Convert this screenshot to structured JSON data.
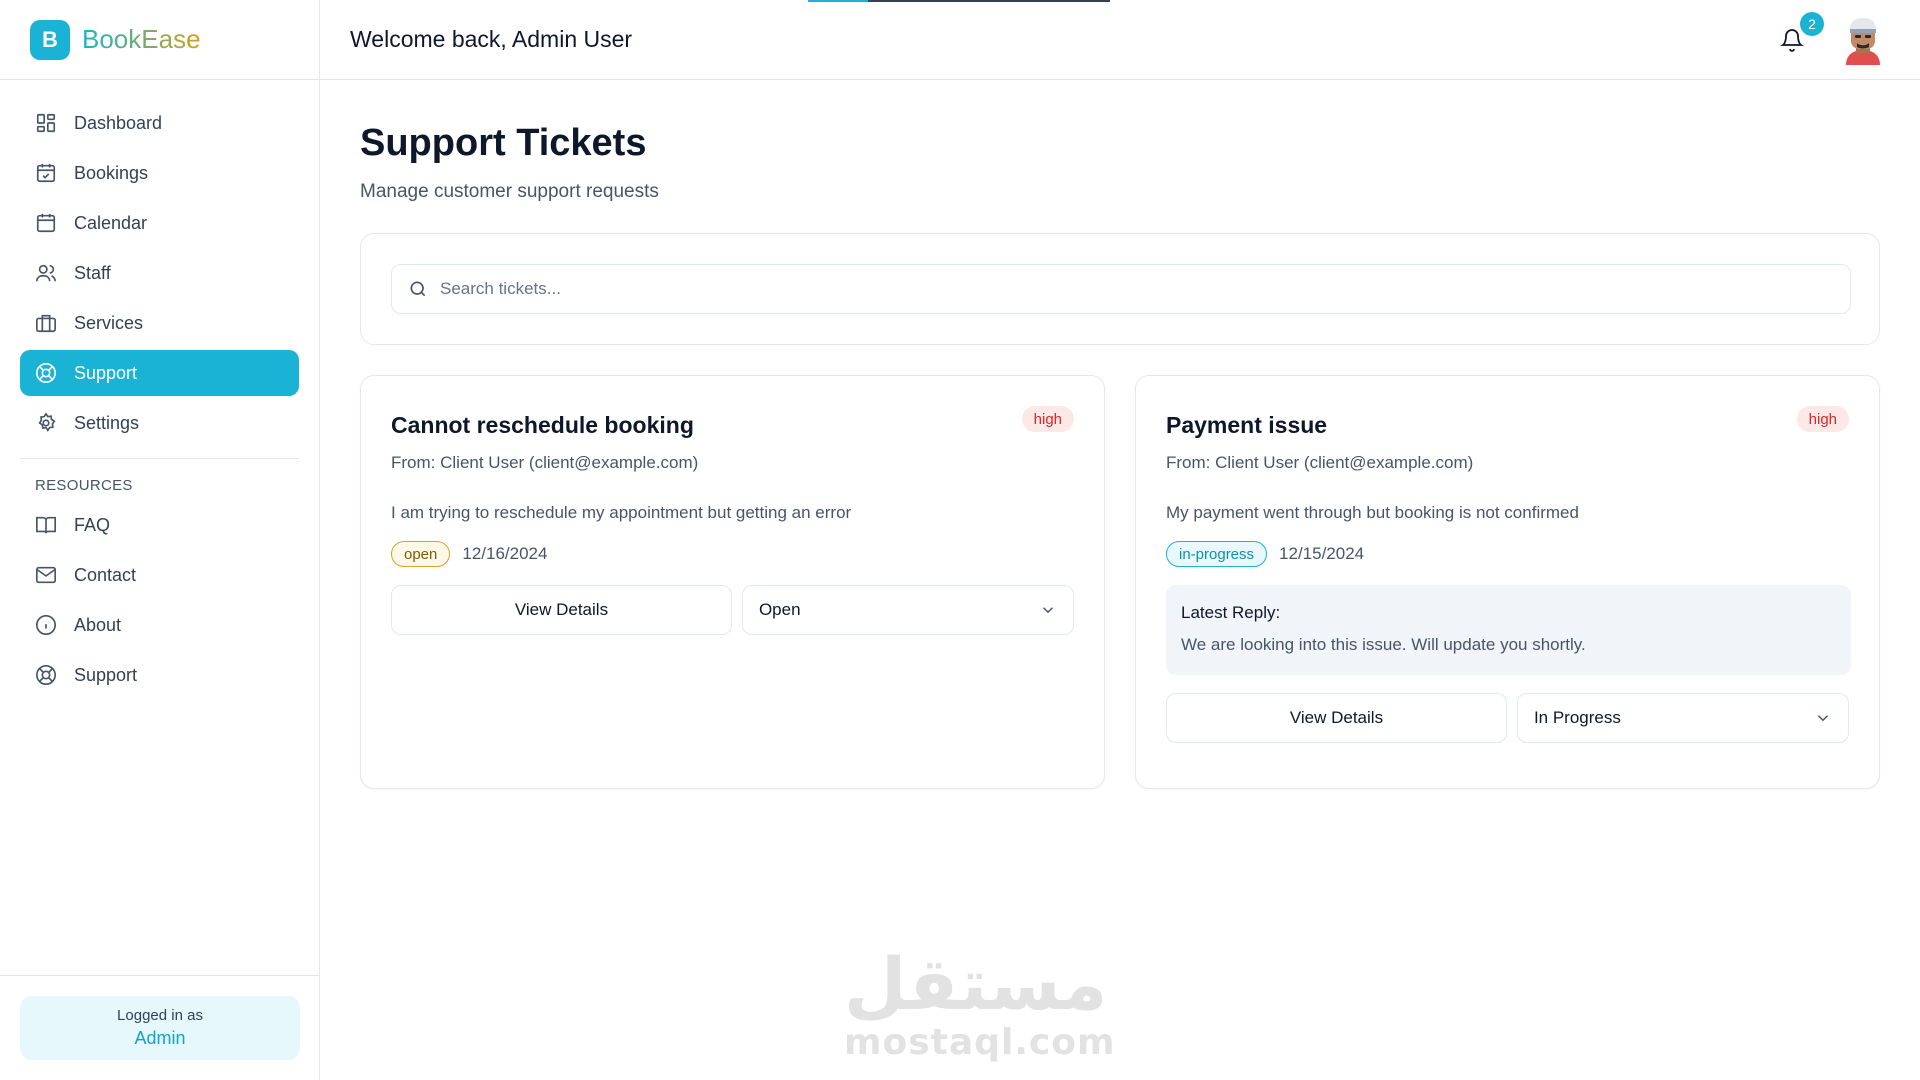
{
  "brand": {
    "logo_letter": "B",
    "name": "BookEase"
  },
  "sidebar": {
    "items": [
      {
        "label": "Dashboard",
        "icon": "dashboard-icon"
      },
      {
        "label": "Bookings",
        "icon": "calendar-check-icon"
      },
      {
        "label": "Calendar",
        "icon": "calendar-icon"
      },
      {
        "label": "Staff",
        "icon": "users-icon"
      },
      {
        "label": "Services",
        "icon": "briefcase-icon"
      },
      {
        "label": "Support",
        "icon": "lifebuoy-icon",
        "active": true
      },
      {
        "label": "Settings",
        "icon": "gear-icon"
      }
    ],
    "resources_heading": "RESOURCES",
    "resources": [
      {
        "label": "FAQ",
        "icon": "book-open-icon"
      },
      {
        "label": "Contact",
        "icon": "mail-icon"
      },
      {
        "label": "About",
        "icon": "info-icon"
      },
      {
        "label": "Support",
        "icon": "lifebuoy-icon"
      }
    ],
    "login_label": "Logged in as",
    "login_role": "Admin"
  },
  "header": {
    "welcome": "Welcome back, Admin User",
    "notification_count": "2"
  },
  "page": {
    "title": "Support Tickets",
    "subtitle": "Manage customer support requests"
  },
  "search": {
    "placeholder": "Search tickets...",
    "value": ""
  },
  "tickets": [
    {
      "title": "Cannot reschedule booking",
      "priority": "high",
      "from": "From: Client User (client@example.com)",
      "message": "I am trying to reschedule my appointment but getting an error",
      "status": "open",
      "date": "12/16/2024",
      "view_label": "View Details",
      "select_value": "Open"
    },
    {
      "title": "Payment issue",
      "priority": "high",
      "from": "From: Client User (client@example.com)",
      "message": "My payment went through but booking is not confirmed",
      "status": "in-progress",
      "date": "12/15/2024",
      "reply_label": "Latest Reply:",
      "reply_text": "We are looking into this issue. Will update you shortly.",
      "view_label": "View Details",
      "select_value": "In Progress"
    }
  ],
  "watermark": {
    "arabic": "مستقل",
    "latin": "mostaql.com"
  },
  "colors": {
    "accent": "#1ab3d6",
    "priority_high": "#dc2626",
    "status_open": "#d9a520"
  }
}
